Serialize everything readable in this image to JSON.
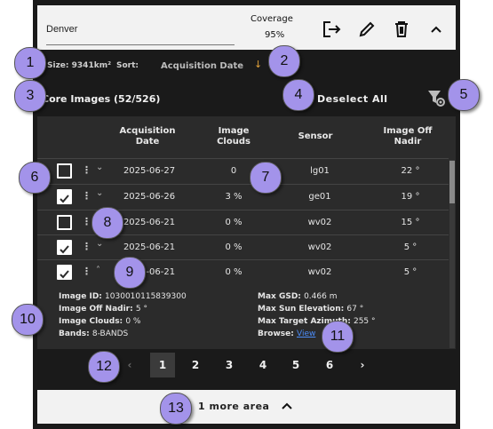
{
  "header": {
    "title": "Denver",
    "coverage_label": "Coverage",
    "coverage_value": "95%",
    "icons": [
      "export-icon",
      "edit-icon",
      "delete-icon",
      "chevron-up-icon"
    ]
  },
  "toolbar": {
    "size_label": "Size:",
    "size_value": "9341km²",
    "sort_label": "Sort:",
    "sort_value": "Acquisition Date",
    "sort_direction_icon": "arrow-down-icon",
    "accent": "#e0a13a"
  },
  "images_header": {
    "title": "Core Images (52/526)",
    "deselect_label": "Deselect All",
    "filter_icon": "filter-settings-icon"
  },
  "table": {
    "columns": [
      "Acquisition Date",
      "Image Clouds",
      "Sensor",
      "Image Off Nadir"
    ],
    "rows": [
      {
        "checked": false,
        "expanded": false,
        "date": "2025-06-27",
        "clouds": "0",
        "sensor": "lg01",
        "off_nadir": "22 °"
      },
      {
        "checked": true,
        "expanded": false,
        "date": "2025-06-26",
        "clouds": "3 %",
        "sensor": "ge01",
        "off_nadir": "19 °"
      },
      {
        "checked": false,
        "expanded": false,
        "date": "2025-06-21",
        "clouds": "0 %",
        "sensor": "wv02",
        "off_nadir": "15 °"
      },
      {
        "checked": true,
        "expanded": false,
        "date": "2025-06-21",
        "clouds": "0 %",
        "sensor": "wv02",
        "off_nadir": "5 °"
      },
      {
        "checked": true,
        "expanded": true,
        "date": "2025-06-21",
        "clouds": "0 %",
        "sensor": "wv02",
        "off_nadir": "5 °"
      }
    ],
    "details": {
      "image_id_label": "Image ID:",
      "image_id": "1030010115839300",
      "off_nadir_label": "Image Off Nadir:",
      "off_nadir": "5 °",
      "clouds_label": "Image Clouds:",
      "clouds": "0 %",
      "bands_label": "Bands:",
      "bands": "8-BANDS",
      "max_gsd_label": "Max GSD:",
      "max_gsd": "0.466 m",
      "max_sun_label": "Max Sun Elevation:",
      "max_sun": "67 °",
      "max_az_label": "Max Target Azimuth:",
      "max_az": "255 °",
      "browse_label": "Browse:",
      "browse_link": "View"
    }
  },
  "pagination": {
    "prev": "‹",
    "pages": [
      "1",
      "2",
      "3",
      "4",
      "5",
      "6"
    ],
    "current": "1",
    "next": "›"
  },
  "footer": {
    "more_label": "1 more area",
    "icon": "chevron-up-icon"
  },
  "annotations": [
    "1",
    "2",
    "3",
    "4",
    "5",
    "6",
    "7",
    "8",
    "9",
    "10",
    "11",
    "12",
    "13"
  ],
  "colors": {
    "badge": "#a393ea",
    "panel": "#1a1a1a",
    "link": "#4b8cf7"
  }
}
